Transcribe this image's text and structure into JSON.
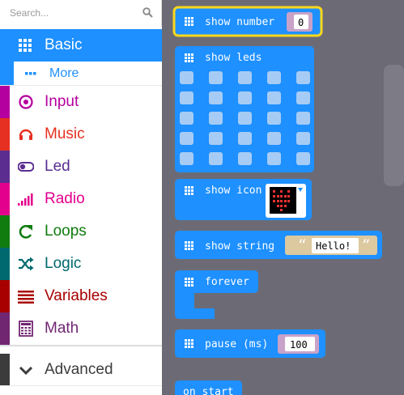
{
  "search": {
    "placeholder": "Search..."
  },
  "categories": [
    {
      "label": "Basic",
      "icon": "grid-icon",
      "color": "#1e90ff"
    },
    {
      "label": "More",
      "icon": "more-dots-icon",
      "color": "#1e90ff"
    },
    {
      "label": "Input",
      "icon": "target-icon",
      "color": "#b4009e"
    },
    {
      "label": "Music",
      "icon": "headphones-icon",
      "color": "#e63022"
    },
    {
      "label": "Led",
      "icon": "toggle-icon",
      "color": "#5c2d91"
    },
    {
      "label": "Radio",
      "icon": "signal-bars-icon",
      "color": "#e3008c"
    },
    {
      "label": "Loops",
      "icon": "refresh-icon",
      "color": "#107c10"
    },
    {
      "label": "Logic",
      "icon": "shuffle-icon",
      "color": "#006970"
    },
    {
      "label": "Variables",
      "icon": "list-lines-icon",
      "color": "#a80000"
    },
    {
      "label": "Math",
      "icon": "calculator-icon",
      "color": "#712672"
    },
    {
      "label": "Advanced",
      "icon": "chevron-down-icon",
      "color": "#3c3c3c"
    }
  ],
  "blocks": {
    "show_number": {
      "label": "show number",
      "value": "0"
    },
    "show_leds": {
      "label": "show leds"
    },
    "show_icon": {
      "label": "show icon"
    },
    "show_string": {
      "label": "show string",
      "open_quote": "“",
      "value": "Hello!",
      "close_quote": "”"
    },
    "forever": {
      "label": "forever"
    },
    "pause": {
      "label": "pause (ms)",
      "value": "100"
    },
    "on_start": {
      "label": "on start"
    }
  },
  "colors": {
    "block": "#1e90ff",
    "highlight": "#f9d71c",
    "workspace": "#6c6b75",
    "number_socket": "#c8a2c8",
    "string_socket": "#dcc9a0"
  }
}
